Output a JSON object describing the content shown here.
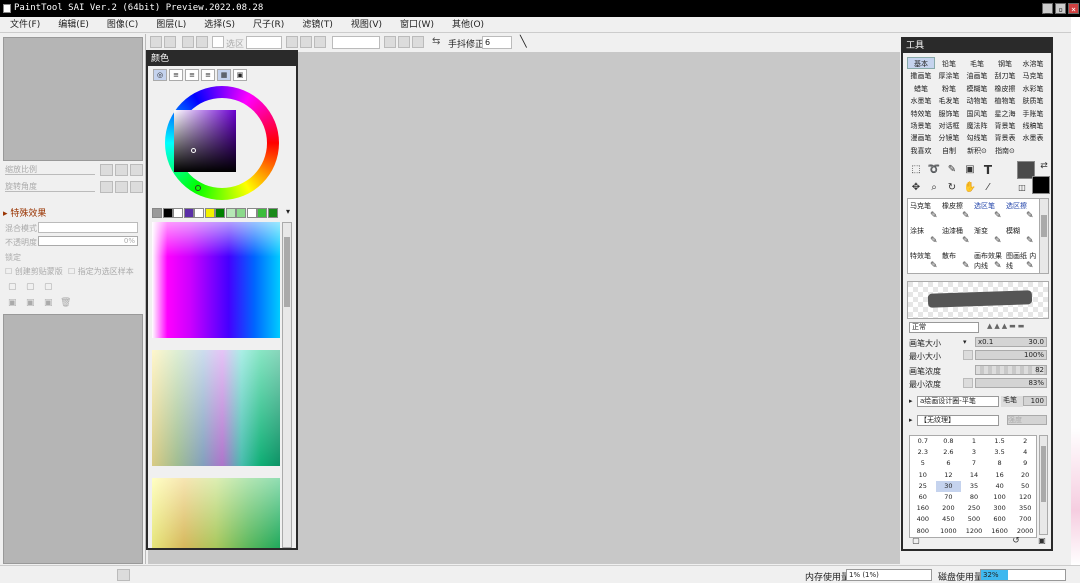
{
  "window": {
    "title": "PaintTool SAI Ver.2 (64bit) Preview.2022.08.28"
  },
  "menu": [
    "文件(F)",
    "编辑(E)",
    "图像(C)",
    "图层(L)",
    "选择(S)",
    "尺子(R)",
    "滤镜(T)",
    "视图(V)",
    "窗口(W)",
    "其他(O)"
  ],
  "toolbar": {
    "select_label": "选区",
    "stabilizer_label": "手抖修正",
    "stabilizer_value": "6"
  },
  "left": {
    "zoom_label": "缩放比例",
    "rotate_label": "旋转角度",
    "effects_label": "特殊效果",
    "blend_label": "混合模式",
    "opacity_label": "不透明度",
    "opacity_value": "0%",
    "lock_label": "锁定",
    "clip_label": "创建剪贴蒙版",
    "selsrc_label": "指定为选区样本"
  },
  "color_panel": {
    "title": "颜色",
    "swatches": [
      "#9a9a9a",
      "#000000",
      "#ffffff",
      "#5a2ea6",
      "#ffffff",
      "#f2f200",
      "#008000",
      "#b7e8b7",
      "#8bd98b",
      "#ffffff",
      "#3cbc3c",
      "#1a8a1a"
    ]
  },
  "tool_panel": {
    "title": "工具",
    "brushes": [
      "基本",
      "铅笔",
      "毛笔",
      "钢笔",
      "水溶笔",
      "撒画笔",
      "厚涂笔",
      "油画笔",
      "刮刀笔",
      "马克笔",
      "蜡笔",
      "粉笔",
      "模糊笔",
      "橡皮擦",
      "水彩笔",
      "水墨笔",
      "毛发笔",
      "动物笔",
      "植物笔",
      "肤质笔",
      "特效笔",
      "服饰笔",
      "国风笔",
      "星之海",
      "手账笔",
      "场景笔",
      "对话框",
      "魔法阵",
      "背景笔",
      "线稿笔",
      "漫画笔",
      "分镜笔",
      "勾线笔",
      "背景表",
      "水墨表",
      "我喜欢",
      "自制",
      "新积⊙",
      "指南⊙",
      ""
    ],
    "subtools": [
      {
        "label": "马克笔",
        "blue": false
      },
      {
        "label": "橡皮擦",
        "blue": false
      },
      {
        "label": "选区笔",
        "blue": true
      },
      {
        "label": "选区擦",
        "blue": true
      },
      {
        "label": "涂抹",
        "blue": false
      },
      {
        "label": "油漆桶",
        "blue": false
      },
      {
        "label": "渐变",
        "blue": false
      },
      {
        "label": "模糊",
        "blue": false
      },
      {
        "label": "特效笔",
        "blue": false
      },
      {
        "label": "散布",
        "blue": false
      },
      {
        "label": "画布效果 内线",
        "blue": false
      },
      {
        "label": "图画纸 内线",
        "blue": false
      }
    ],
    "blend_mode": "正常",
    "brush_size_label": "画笔大小",
    "brush_size_mult": "x0.1",
    "brush_size_value": "30.0",
    "min_size_label": "最小大小",
    "min_size_value": "100%",
    "density_label": "画笔浓度",
    "density_value": "82",
    "min_density_label": "最小浓度",
    "min_density_value": "83%",
    "brush_shape": "a绘画设计圈-平笔",
    "brush_type": "毛笔",
    "brush_type_value": "100",
    "texture": "【无纹理】",
    "texture_strength": "强度",
    "sizes": [
      "0.7",
      "0.8",
      "1",
      "1.5",
      "2",
      "2.3",
      "2.6",
      "3",
      "3.5",
      "4",
      "5",
      "6",
      "7",
      "8",
      "9",
      "10",
      "12",
      "14",
      "16",
      "20",
      "25",
      "30",
      "35",
      "40",
      "50",
      "60",
      "70",
      "80",
      "100",
      "120",
      "160",
      "200",
      "250",
      "300",
      "350",
      "400",
      "450",
      "500",
      "600",
      "700",
      "800",
      "1000",
      "1200",
      "1600",
      "2000"
    ],
    "selected_size": "30"
  },
  "status": {
    "mem_label": "内存使用量",
    "mem_value": "1% (1%)",
    "disk_label": "磁盘使用量",
    "disk_value": "32%",
    "disk_fraction": 0.32
  },
  "colors": {
    "accent": "#c5d3ee",
    "titlebar": "#2a2a2a",
    "canvas": "#c8c8c8"
  }
}
